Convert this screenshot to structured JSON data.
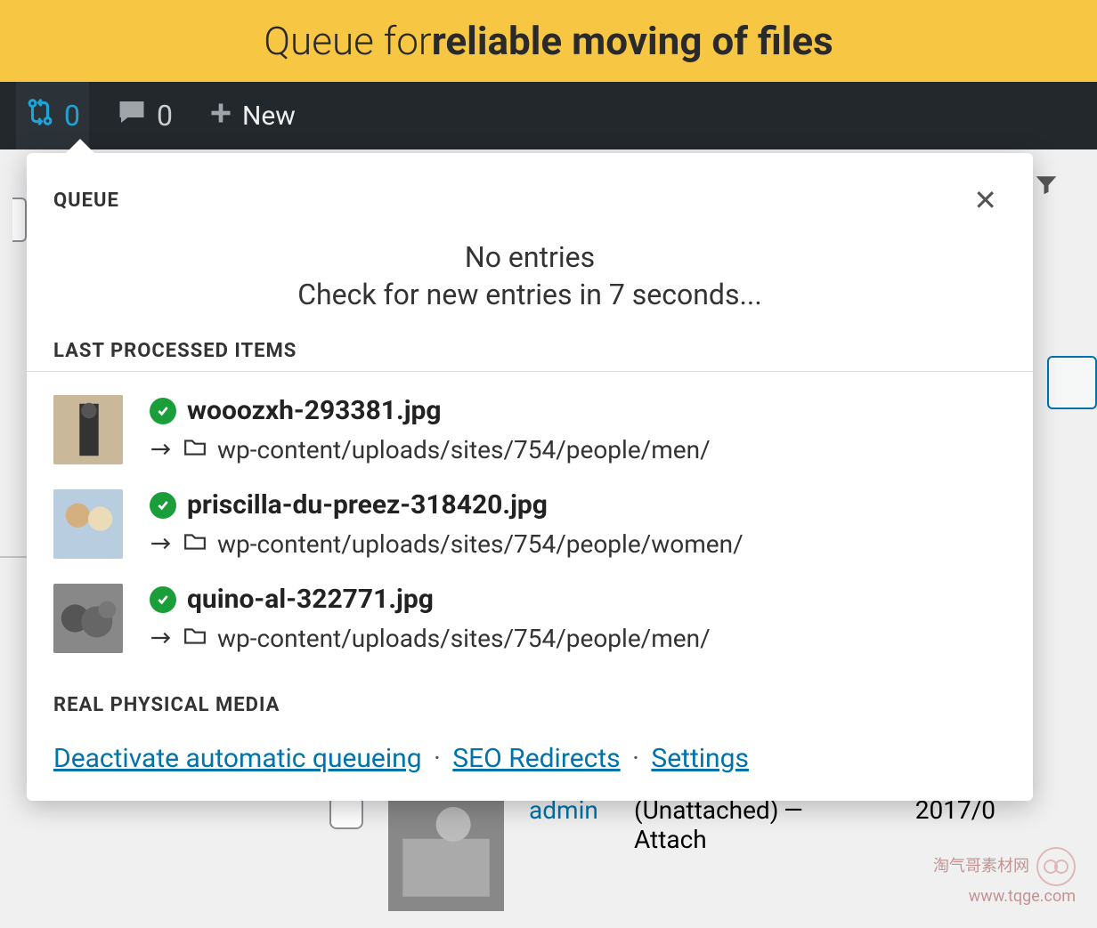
{
  "banner": {
    "prefix": "Queue for ",
    "strong": "reliable moving of files"
  },
  "adminbar": {
    "queue_count": "0",
    "comment_count": "0",
    "new_label": "New"
  },
  "panel": {
    "title": "QUEUE",
    "no_entries": "No entries",
    "check_prefix": "Check for new entries in ",
    "check_seconds": "7",
    "check_suffix": " seconds...",
    "last_title": "LAST PROCESSED ITEMS",
    "items": [
      {
        "filename": "wooozxh-293381.jpg",
        "path": "wp-content/uploads/sites/754/people/men/"
      },
      {
        "filename": "priscilla-du-preez-318420.jpg",
        "path": "wp-content/uploads/sites/754/people/women/"
      },
      {
        "filename": "quino-al-322771.jpg",
        "path": "wp-content/uploads/sites/754/people/men/"
      }
    ],
    "footer_title": "REAL PHYSICAL MEDIA",
    "links": {
      "deactivate": "Deactivate automatic queueing",
      "seo": "SEO Redirects",
      "settings": "Settings"
    }
  },
  "bg_row": {
    "author": "admin",
    "status": "(Unattached)",
    "attach": "Attach",
    "dash": "—",
    "date": "2017/0"
  },
  "watermark": {
    "line1": "淘气哥素材网",
    "line2": "www.tqge.com"
  }
}
